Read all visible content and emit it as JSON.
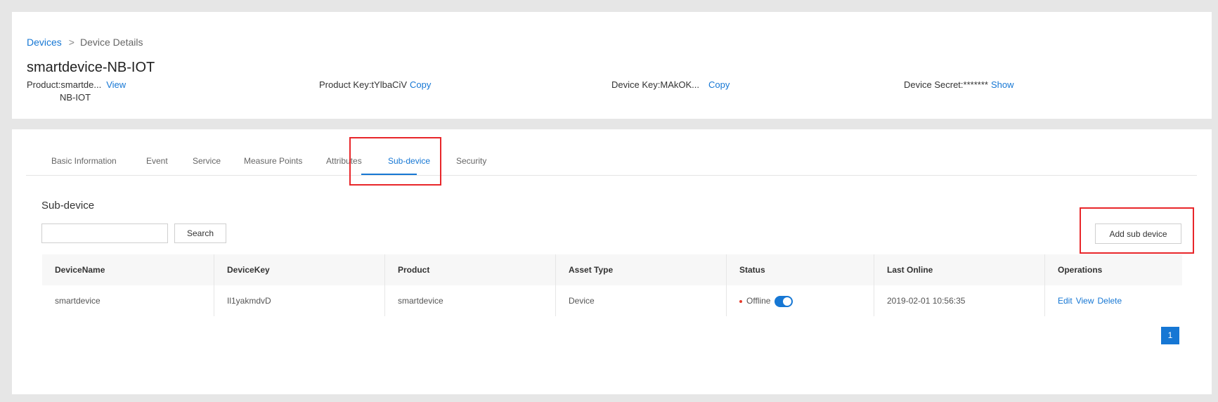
{
  "breadcrumb": {
    "root": "Devices",
    "separator": ">",
    "current": "Device Details"
  },
  "device": {
    "title": "smartdevice-NB-IOT",
    "product_label": "Product:smartde...",
    "product_label_line2": "NB-IOT",
    "product_action": "View",
    "product_key_label": "Product Key:tYlbaCiV",
    "product_key_action": "Copy",
    "device_key_label": "Device Key:MAkOK...",
    "device_key_action": "Copy",
    "device_secret_label": "Device Secret:*******",
    "device_secret_action": "Show"
  },
  "tabs": [
    {
      "label": "Basic Information"
    },
    {
      "label": "Event"
    },
    {
      "label": "Service"
    },
    {
      "label": "Measure Points"
    },
    {
      "label": "Attributes"
    },
    {
      "label": "Sub-device",
      "active": true
    },
    {
      "label": "Security"
    }
  ],
  "section": {
    "title": "Sub-device",
    "search_value": "",
    "search_button": "Search",
    "add_button": "Add sub device"
  },
  "table": {
    "columns": [
      "DeviceName",
      "DeviceKey",
      "Product",
      "Asset Type",
      "Status",
      "Last Online",
      "Operations"
    ],
    "rows": [
      {
        "device_name": "smartdevice",
        "device_key": "Il1yakmdvD",
        "product": "smartdevice",
        "asset_type": "Device",
        "status": "Offline",
        "enabled": true,
        "last_online": "2019-02-01 10:56:35",
        "ops": [
          "Edit",
          "View",
          "Delete"
        ]
      }
    ]
  },
  "pagination": {
    "current_page": "1"
  },
  "colors": {
    "accent": "#1677d4",
    "highlight": "#e8262a",
    "offline_dot": "#e53b2c"
  }
}
